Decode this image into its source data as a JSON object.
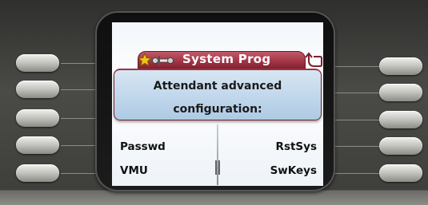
{
  "display": {
    "title": "System Prog",
    "prompt_line1": "Attendant advanced",
    "prompt_line2": "configuration:"
  },
  "softkeys": {
    "left_top": "Passwd",
    "left_bottom": "VMU",
    "right_top": "RstSys",
    "right_bottom": "SwKeys"
  },
  "icons": {
    "title_left": "star-icon",
    "title_tools": "tools-icon",
    "back": "back-arrow-icon"
  },
  "colors": {
    "title_bar": "#9e3142",
    "prompt_bg": "#aecae4",
    "bezel": "#3a3a38"
  }
}
